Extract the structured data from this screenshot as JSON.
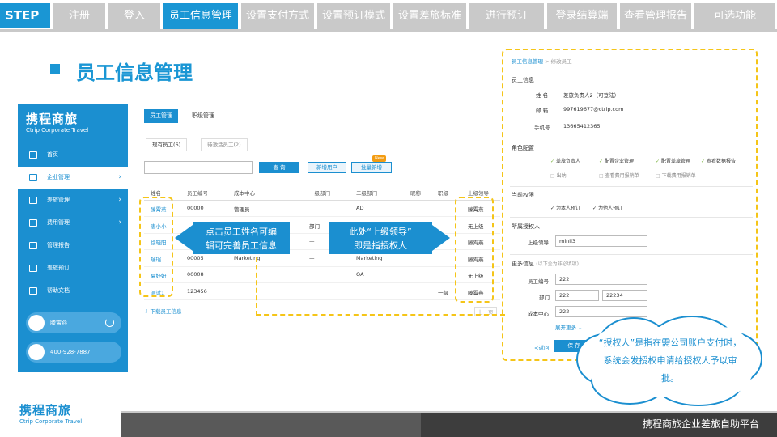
{
  "step_bar": {
    "label": "STEP",
    "tabs": [
      {
        "label": "注册",
        "active": false
      },
      {
        "label": "登入",
        "active": false
      },
      {
        "label": "员工信息管理",
        "active": true
      },
      {
        "label": "设置支付方式",
        "active": false
      },
      {
        "label": "设置预订模式",
        "active": false
      },
      {
        "label": "设置差旅标准",
        "active": false
      },
      {
        "label": "进行预订",
        "active": false
      },
      {
        "label": "登录结算端",
        "active": false
      },
      {
        "label": "查看管理报告",
        "active": false
      },
      {
        "label": "可选功能",
        "active": false
      }
    ]
  },
  "page_title": "员工信息管理",
  "sidebar": {
    "logo_cn": "携程商旅",
    "logo_en": "Ctrip Corporate Travel",
    "items": [
      {
        "label": "首页",
        "icon": "home-icon",
        "active": false,
        "chevron": false
      },
      {
        "label": "企业管理",
        "icon": "people-icon",
        "active": true,
        "chevron": true
      },
      {
        "label": "差旅管理",
        "icon": "chart-icon",
        "active": false,
        "chevron": true
      },
      {
        "label": "费用管理",
        "icon": "coin-icon",
        "active": false,
        "chevron": true
      },
      {
        "label": "管理报告",
        "icon": "report-icon",
        "active": false,
        "chevron": false
      },
      {
        "label": "差旅预订",
        "icon": "cart-icon",
        "active": false,
        "chevron": false
      },
      {
        "label": "帮助文档",
        "icon": "doc-icon",
        "active": false,
        "chevron": false
      }
    ],
    "user_name": "滕霄燕",
    "phone": "400-928-7887"
  },
  "main": {
    "tabs": [
      "员工管理",
      "职级管理"
    ],
    "subtabs": [
      "现有员工(6)",
      "待激活员工(2)"
    ],
    "search_button": "查 询",
    "add_user_button": "新增用户",
    "bulk_add_button": "批量新增",
    "new_badge": "New",
    "columns": [
      "姓名",
      "员工编号",
      "成本中心",
      "一级部门",
      "二级部门",
      "昵称",
      "职级",
      "上级领导"
    ],
    "rows": [
      [
        "滕霄燕",
        "00000",
        "管理员",
        "",
        "AD",
        "",
        "",
        "滕霄燕"
      ],
      [
        "唐小小",
        "",
        "",
        "部门",
        "",
        "",
        "",
        "无上级"
      ],
      [
        "徐晓阳",
        "",
        "",
        "—",
        "",
        "",
        "",
        "滕霄燕"
      ],
      [
        "瑞瑞",
        "00005",
        "Marketing",
        "—",
        "Marketing",
        "",
        "",
        "滕霄燕"
      ],
      [
        "夏妤妍",
        "00008",
        "",
        "",
        "QA",
        "",
        "",
        "无上级"
      ],
      [
        "测试1",
        "123456",
        "",
        "",
        "",
        "",
        "一级",
        "滕霄燕"
      ]
    ],
    "download_link": "下载员工信息",
    "pager_text": "上一页"
  },
  "callouts": {
    "left": "点击员工姓名可编\n辑可完善员工信息",
    "right": "此处“上级领导”\n即是指授权人"
  },
  "form": {
    "breadcrumb_root": "员工信息管理",
    "breadcrumb_sep": ">",
    "breadcrumb_current": "修改员工",
    "section_info": "员工信息",
    "name_label": "姓 名",
    "name_value": "差旅负责人2（可登陆）",
    "email_label": "邮 箱",
    "email_value": "997619677@ctrip.com",
    "phone_label": "手机号",
    "phone_value": "13665412365",
    "section_roles": "角色配置",
    "roles": [
      {
        "label": "差旅负责人",
        "checked": true
      },
      {
        "label": "配置企业管理",
        "checked": true
      },
      {
        "label": "配置差旅管理",
        "checked": true
      },
      {
        "label": "查看数据报告",
        "checked": true
      },
      {
        "label": "出纳",
        "checked": false
      },
      {
        "label": "查看费用报销单",
        "checked": false
      },
      {
        "label": "下载费用报销单",
        "checked": false
      }
    ],
    "section_perm": "当前权限",
    "perms": [
      {
        "label": "为本人预订",
        "checked": true
      },
      {
        "label": "为他人预订",
        "checked": true
      }
    ],
    "section_approver": "所属授权人",
    "approver_label": "上级领导",
    "approver_value": "minii3",
    "section_more": "更多信息",
    "section_more_note": "(以下全为非必填项)",
    "emp_no_label": "员工编号",
    "emp_no_value": "222",
    "dept_label": "部门",
    "dept_value1": "222",
    "dept_value2": "22234",
    "cost_label": "成本中心",
    "cost_value": "222",
    "expand_link": "展开更多",
    "back_link": "<返回",
    "save_button": "保 存"
  },
  "cloud_note": "“授权人”是指在需公司账户支付时，系统会发授权申请给授权人予以审批。",
  "footer": {
    "logo_cn": "携程商旅",
    "logo_en": "Ctrip Corporate Travel",
    "text": "携程商旅企业差旅自助平台"
  },
  "colors": {
    "accent": "#1a96d4",
    "highlight": "#f5c518",
    "tab_inactive": "#c9c9c9"
  }
}
